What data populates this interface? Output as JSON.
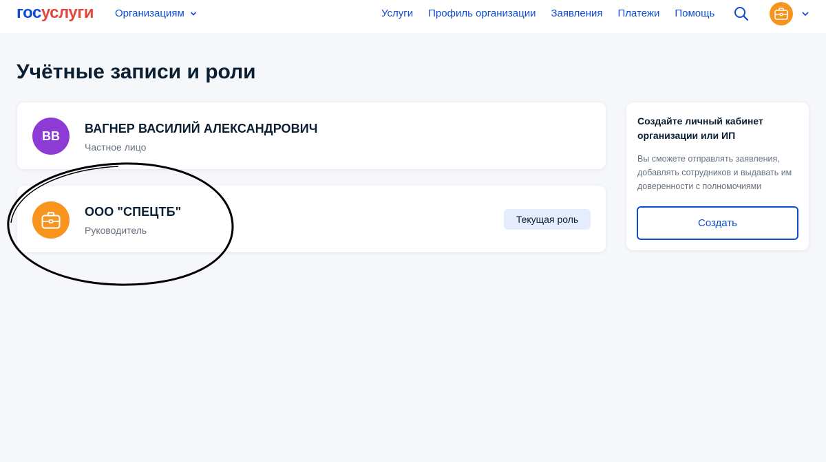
{
  "header": {
    "logo_part1": "гос",
    "logo_part2": "услуги",
    "org_menu_label": "Организациям",
    "nav": [
      "Услуги",
      "Профиль организации",
      "Заявления",
      "Платежи",
      "Помощь"
    ]
  },
  "page": {
    "title": "Учётные записи и роли"
  },
  "accounts": [
    {
      "initials": "ВВ",
      "name": "ВАГНЕР ВАСИЛИЙ АЛЕКСАНДРОВИЧ",
      "role": "Частное лицо"
    },
    {
      "name": "ООО \"СПЕЦТБ\"",
      "role": "Руководитель",
      "badge": "Текущая роль"
    }
  ],
  "create_panel": {
    "title": "Создайте личный кабинет организации или ИП",
    "description": "Вы сможете отправлять заявления, добавлять сотрудников и выдавать им доверенности с полномочиями",
    "button_label": "Создать"
  },
  "colors": {
    "brand_blue": "#0d4cd3",
    "brand_red": "#e3463a",
    "avatar_purple": "#8e3bd6",
    "org_orange": "#f7941d",
    "badge_bg": "#e4ecfd"
  },
  "icons": {
    "search": "search-icon",
    "briefcase": "briefcase-icon",
    "chevron": "chevron-down-icon"
  }
}
